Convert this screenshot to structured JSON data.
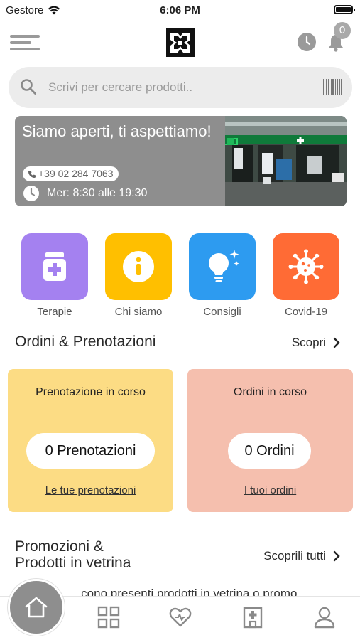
{
  "status_bar": {
    "carrier": "Gestore",
    "time": "6:06 PM"
  },
  "header": {
    "notifications_count": "0"
  },
  "search": {
    "placeholder": "Scrivi per cercare prodotti.."
  },
  "banner": {
    "title": "Siamo aperti, ti aspettiamo!",
    "phone": "+39 02 284 7063",
    "hours": "Mer: 8:30 alle 19:30"
  },
  "categories": [
    {
      "label": "Terapie",
      "color": "#a481f0",
      "icon": "medicine-jar-icon"
    },
    {
      "label": "Chi siamo",
      "color": "#ffbf00",
      "icon": "info-icon"
    },
    {
      "label": "Consigli",
      "color": "#2d9bf0",
      "icon": "lightbulb-icon"
    },
    {
      "label": "Covid-19",
      "color": "#ff6b35",
      "icon": "virus-icon"
    }
  ],
  "orders_section": {
    "title": "Ordini & Prenotazioni",
    "link": "Scopri",
    "cards": [
      {
        "title": "Prenotazione in corso",
        "count": "0 Prenotazioni",
        "link": "Le tue prenotazioni",
        "color": "#fcdc84"
      },
      {
        "title": "Ordini in corso",
        "count": "0 Ordini",
        "link": "I tuoi ordini",
        "color": "#f5bfae"
      }
    ]
  },
  "promo_section": {
    "title_line1": "Promozioni &",
    "title_line2": "Prodotti in vetrina",
    "link": "Scoprili tutti",
    "peek_text": "...cono presenti prodotti in vetrina o promo"
  },
  "bottom_nav": {
    "items": [
      "home-icon",
      "grid-icon",
      "heart-icon",
      "pharmacy-icon",
      "user-icon"
    ]
  }
}
